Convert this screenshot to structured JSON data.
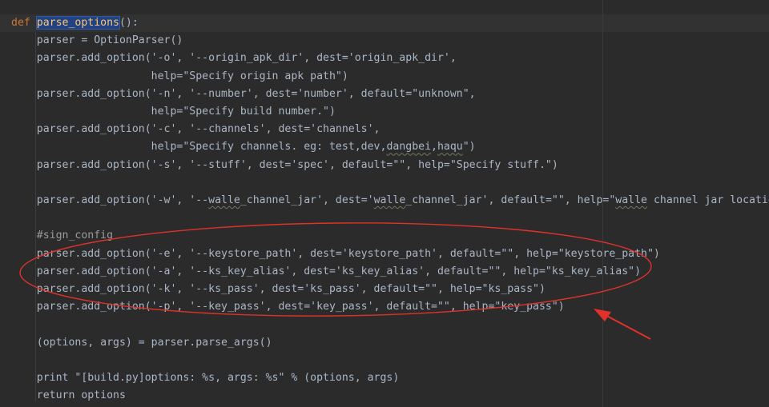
{
  "code_lines": [
    {
      "tokens": [
        {
          "t": "def ",
          "c": "kw"
        },
        {
          "t": "parse_options",
          "c": "fn-sel"
        },
        {
          "t": "():",
          "c": ""
        }
      ]
    },
    {
      "tokens": [
        {
          "t": "    parser = OptionParser()",
          "c": ""
        }
      ]
    },
    {
      "tokens": [
        {
          "t": "    parser.add_option('-o', '--origin_apk_dir', dest='origin_apk_dir',",
          "c": ""
        }
      ]
    },
    {
      "tokens": [
        {
          "t": "                      help=\"Specify origin apk path\")",
          "c": ""
        }
      ]
    },
    {
      "tokens": [
        {
          "t": "    parser.add_option('-n', '--number', dest='number', default=\"unknown\",",
          "c": ""
        }
      ]
    },
    {
      "tokens": [
        {
          "t": "                      help=\"Specify build number.\")",
          "c": ""
        }
      ]
    },
    {
      "tokens": [
        {
          "t": "    parser.add_option('-c', '--channels', dest='channels',",
          "c": ""
        }
      ]
    },
    {
      "tokens": [
        {
          "t": "                      help=\"Specify channels. eg: test,dev,",
          "c": ""
        },
        {
          "t": "dangbei",
          "c": "squiggle"
        },
        {
          "t": ",",
          "c": ""
        },
        {
          "t": "haqu",
          "c": "squiggle"
        },
        {
          "t": "\")",
          "c": ""
        }
      ]
    },
    {
      "tokens": [
        {
          "t": "    parser.add_option('-s', '--stuff', dest='spec', default=\"\", help=\"Specify stuff.\")",
          "c": ""
        }
      ]
    },
    {
      "tokens": [
        {
          "t": "",
          "c": ""
        }
      ]
    },
    {
      "tokens": [
        {
          "t": "    parser.add_option('-w', '--",
          "c": ""
        },
        {
          "t": "walle",
          "c": "squiggle"
        },
        {
          "t": "_channel_jar', dest='",
          "c": ""
        },
        {
          "t": "walle",
          "c": "squiggle"
        },
        {
          "t": "_channel_jar', default=\"\", help=\"",
          "c": ""
        },
        {
          "t": "walle",
          "c": "squiggle"
        },
        {
          "t": " channel jar location.\")",
          "c": ""
        }
      ]
    },
    {
      "tokens": [
        {
          "t": "",
          "c": ""
        }
      ]
    },
    {
      "tokens": [
        {
          "t": "    #sign_config",
          "c": "comment"
        }
      ]
    },
    {
      "tokens": [
        {
          "t": "    parser.add_option('-e', '--keystore_path', dest='keystore_path', default=\"\", help=\"keystore_path\")",
          "c": ""
        }
      ]
    },
    {
      "tokens": [
        {
          "t": "    parser.add_option('-a', '--ks_key_alias', dest='ks_key_alias', default=\"\", help=\"ks_key_alias\")",
          "c": ""
        }
      ]
    },
    {
      "tokens": [
        {
          "t": "    parser.add_option('-k', '--ks_pass', dest='ks_pass', default=\"\", help=\"ks_pass\")",
          "c": ""
        }
      ]
    },
    {
      "tokens": [
        {
          "t": "    parser.add_option('-p', '--key_pass', dest='key_pass', default=\"\", help=\"key_pass\")",
          "c": ""
        }
      ]
    },
    {
      "tokens": [
        {
          "t": "",
          "c": ""
        }
      ]
    },
    {
      "tokens": [
        {
          "t": "    (options, args) = parser.parse_args()",
          "c": ""
        }
      ]
    },
    {
      "tokens": [
        {
          "t": "",
          "c": ""
        }
      ]
    },
    {
      "tokens": [
        {
          "t": "    print \"[build.py]options: %s, args: %s\" % (options, args)",
          "c": ""
        }
      ]
    },
    {
      "tokens": [
        {
          "t": "    return options",
          "c": ""
        }
      ]
    }
  ],
  "colors": {
    "background": "#2b2b2b",
    "text": "#a9b7c6",
    "keyword": "#cc7832",
    "function_selected": "#ffc66d",
    "selection": "#214283",
    "annotation_red": "#e0322a"
  }
}
